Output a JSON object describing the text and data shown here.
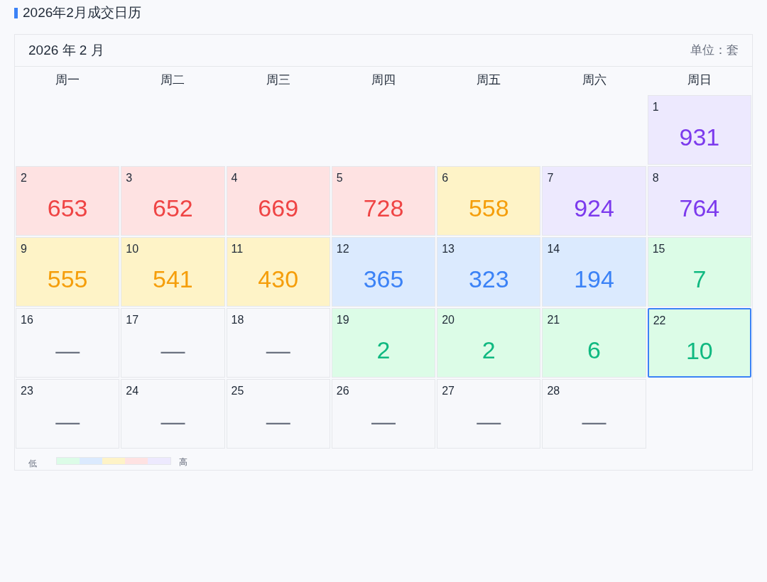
{
  "title": "2026年2月成交日历",
  "calendar": {
    "month_label": "2026 年 2 月",
    "unit": "单位：套",
    "weekdays": [
      "周一",
      "周二",
      "周三",
      "周四",
      "周五",
      "周六",
      "周日"
    ],
    "weeks": [
      [
        {
          "kind": "blank"
        },
        {
          "kind": "blank"
        },
        {
          "kind": "blank"
        },
        {
          "kind": "blank"
        },
        {
          "kind": "blank"
        },
        {
          "kind": "blank"
        },
        {
          "kind": "day",
          "day": "1",
          "value": "931",
          "color": "#ede9fe",
          "selected": false
        }
      ],
      [
        {
          "kind": "day",
          "day": "2",
          "value": "653",
          "color": "#fee2e2",
          "selected": false
        },
        {
          "kind": "day",
          "day": "3",
          "value": "652",
          "color": "#fee2e2",
          "selected": false
        },
        {
          "kind": "day",
          "day": "4",
          "value": "669",
          "color": "#fee2e2",
          "selected": false
        },
        {
          "kind": "day",
          "day": "5",
          "value": "728",
          "color": "#fee2e2",
          "selected": false
        },
        {
          "kind": "day",
          "day": "6",
          "value": "558",
          "color": "#fef3c7",
          "selected": false
        },
        {
          "kind": "day",
          "day": "7",
          "value": "924",
          "color": "#ede9fe",
          "selected": false
        },
        {
          "kind": "day",
          "day": "8",
          "value": "764",
          "color": "#ede9fe",
          "selected": false
        }
      ],
      [
        {
          "kind": "day",
          "day": "9",
          "value": "555",
          "color": "#fef3c7",
          "selected": false
        },
        {
          "kind": "day",
          "day": "10",
          "value": "541",
          "color": "#fef3c7",
          "selected": false
        },
        {
          "kind": "day",
          "day": "11",
          "value": "430",
          "color": "#fef3c7",
          "selected": false
        },
        {
          "kind": "day",
          "day": "12",
          "value": "365",
          "color": "#dbeafe",
          "selected": false
        },
        {
          "kind": "day",
          "day": "13",
          "value": "323",
          "color": "#dbeafe",
          "selected": false
        },
        {
          "kind": "day",
          "day": "14",
          "value": "194",
          "color": "#dbeafe",
          "selected": false
        },
        {
          "kind": "day",
          "day": "15",
          "value": "7",
          "color": "#dcfce7",
          "selected": false
        }
      ],
      [
        {
          "kind": "day",
          "day": "16",
          "value": "—",
          "color": "#f7f8fb",
          "selected": false
        },
        {
          "kind": "day",
          "day": "17",
          "value": "—",
          "color": "#f7f8fb",
          "selected": false
        },
        {
          "kind": "day",
          "day": "18",
          "value": "—",
          "color": "#f7f8fb",
          "selected": false
        },
        {
          "kind": "day",
          "day": "19",
          "value": "2",
          "color": "#dcfce7",
          "selected": false
        },
        {
          "kind": "day",
          "day": "20",
          "value": "2",
          "color": "#dcfce7",
          "selected": false
        },
        {
          "kind": "day",
          "day": "21",
          "value": "6",
          "color": "#dcfce7",
          "selected": false
        },
        {
          "kind": "day",
          "day": "22",
          "value": "10",
          "color": "#dcfce7",
          "selected": true
        }
      ],
      [
        {
          "kind": "day",
          "day": "23",
          "value": "—",
          "color": "#f7f8fb",
          "selected": false
        },
        {
          "kind": "day",
          "day": "24",
          "value": "—",
          "color": "#f7f8fb",
          "selected": false
        },
        {
          "kind": "day",
          "day": "25",
          "value": "—",
          "color": "#f7f8fb",
          "selected": false
        },
        {
          "kind": "day",
          "day": "26",
          "value": "—",
          "color": "#f7f8fb",
          "selected": false
        },
        {
          "kind": "day",
          "day": "27",
          "value": "—",
          "color": "#f7f8fb",
          "selected": false
        },
        {
          "kind": "day",
          "day": "28",
          "value": "—",
          "color": "#f7f8fb",
          "selected": false
        },
        {
          "kind": "blank"
        }
      ]
    ]
  },
  "legend": {
    "low_label": "低",
    "high_label": "高",
    "swatches": [
      {
        "color": "#dcfce7"
      },
      {
        "color": "#dbeafe"
      },
      {
        "color": "#fef3c7"
      },
      {
        "color": "#fee2e2"
      },
      {
        "color": "#ede9fe"
      }
    ]
  }
}
